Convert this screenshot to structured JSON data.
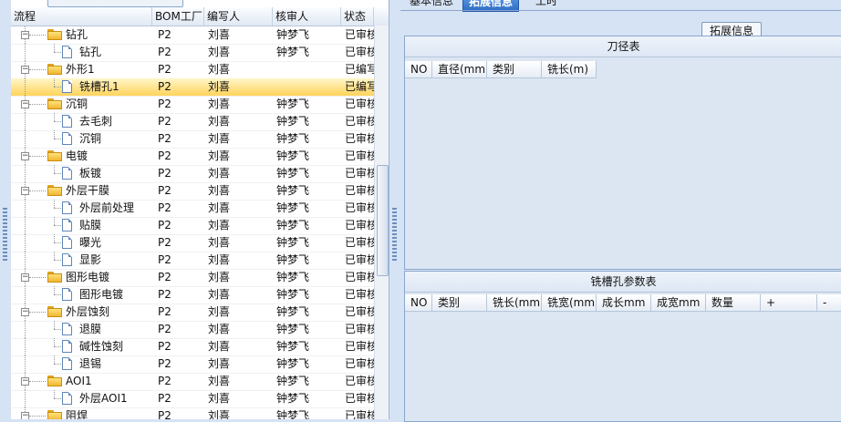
{
  "tree": {
    "columns": [
      "流程",
      "BOM工厂",
      "编写人",
      "核审人",
      "状态"
    ],
    "rows": [
      {
        "level": 1,
        "type": "folder",
        "name": "钻孔",
        "bom": "P2",
        "writer": "刘喜",
        "reviewer": "钟梦飞",
        "status": "已审核",
        "selected": false
      },
      {
        "level": 2,
        "type": "doc",
        "name": "钻孔",
        "bom": "P2",
        "writer": "刘喜",
        "reviewer": "钟梦飞",
        "status": "已审核",
        "selected": false
      },
      {
        "level": 1,
        "type": "folder",
        "name": "外形1",
        "bom": "P2",
        "writer": "刘喜",
        "reviewer": "",
        "status": "已编写",
        "selected": false
      },
      {
        "level": 2,
        "type": "doc",
        "name": "铣槽孔1",
        "bom": "P2",
        "writer": "刘喜",
        "reviewer": "",
        "status": "已编写",
        "selected": true
      },
      {
        "level": 1,
        "type": "folder",
        "name": "沉铜",
        "bom": "P2",
        "writer": "刘喜",
        "reviewer": "钟梦飞",
        "status": "已审核",
        "selected": false
      },
      {
        "level": 2,
        "type": "doc",
        "name": "去毛刺",
        "bom": "P2",
        "writer": "刘喜",
        "reviewer": "钟梦飞",
        "status": "已审核",
        "selected": false
      },
      {
        "level": 2,
        "type": "doc",
        "name": "沉铜",
        "bom": "P2",
        "writer": "刘喜",
        "reviewer": "钟梦飞",
        "status": "已审核",
        "selected": false
      },
      {
        "level": 1,
        "type": "folder",
        "name": "电镀",
        "bom": "P2",
        "writer": "刘喜",
        "reviewer": "钟梦飞",
        "status": "已审核",
        "selected": false
      },
      {
        "level": 2,
        "type": "doc",
        "name": "板镀",
        "bom": "P2",
        "writer": "刘喜",
        "reviewer": "钟梦飞",
        "status": "已审核",
        "selected": false
      },
      {
        "level": 1,
        "type": "folder",
        "name": "外层干膜",
        "bom": "P2",
        "writer": "刘喜",
        "reviewer": "钟梦飞",
        "status": "已审核",
        "selected": false
      },
      {
        "level": 2,
        "type": "doc",
        "name": "外层前处理",
        "bom": "P2",
        "writer": "刘喜",
        "reviewer": "钟梦飞",
        "status": "已审核",
        "selected": false
      },
      {
        "level": 2,
        "type": "doc",
        "name": "贴膜",
        "bom": "P2",
        "writer": "刘喜",
        "reviewer": "钟梦飞",
        "status": "已审核",
        "selected": false
      },
      {
        "level": 2,
        "type": "doc",
        "name": "曝光",
        "bom": "P2",
        "writer": "刘喜",
        "reviewer": "钟梦飞",
        "status": "已审核",
        "selected": false
      },
      {
        "level": 2,
        "type": "doc",
        "name": "显影",
        "bom": "P2",
        "writer": "刘喜",
        "reviewer": "钟梦飞",
        "status": "已审核",
        "selected": false
      },
      {
        "level": 1,
        "type": "folder",
        "name": "图形电镀",
        "bom": "P2",
        "writer": "刘喜",
        "reviewer": "钟梦飞",
        "status": "已审核",
        "selected": false
      },
      {
        "level": 2,
        "type": "doc",
        "name": "图形电镀",
        "bom": "P2",
        "writer": "刘喜",
        "reviewer": "钟梦飞",
        "status": "已审核",
        "selected": false
      },
      {
        "level": 1,
        "type": "folder",
        "name": "外层蚀刻",
        "bom": "P2",
        "writer": "刘喜",
        "reviewer": "钟梦飞",
        "status": "已审核",
        "selected": false
      },
      {
        "level": 2,
        "type": "doc",
        "name": "退膜",
        "bom": "P2",
        "writer": "刘喜",
        "reviewer": "钟梦飞",
        "status": "已审核",
        "selected": false
      },
      {
        "level": 2,
        "type": "doc",
        "name": "碱性蚀刻",
        "bom": "P2",
        "writer": "刘喜",
        "reviewer": "钟梦飞",
        "status": "已审核",
        "selected": false
      },
      {
        "level": 2,
        "type": "doc",
        "name": "退锡",
        "bom": "P2",
        "writer": "刘喜",
        "reviewer": "钟梦飞",
        "status": "已审核",
        "selected": false
      },
      {
        "level": 1,
        "type": "folder",
        "name": "AOI1",
        "bom": "P2",
        "writer": "刘喜",
        "reviewer": "钟梦飞",
        "status": "已审核",
        "selected": false
      },
      {
        "level": 2,
        "type": "doc",
        "name": "外层AOI1",
        "bom": "P2",
        "writer": "刘喜",
        "reviewer": "钟梦飞",
        "status": "已审核",
        "selected": false
      },
      {
        "level": 1,
        "type": "folder",
        "name": "阻焊",
        "bom": "P2",
        "writer": "刘喜",
        "reviewer": "钟梦飞",
        "status": "已审核",
        "selected": false
      }
    ]
  },
  "tabs": [
    {
      "label": "基本信息",
      "active": false
    },
    {
      "label": "拓展信息",
      "active": true
    },
    {
      "label": "工时",
      "active": false
    }
  ],
  "groupbox_title": "拓展信息",
  "cutter_table": {
    "title": "刀径表",
    "columns": [
      "NO",
      "直径(mm)",
      "类别",
      "铣长(m)"
    ]
  },
  "slot_table": {
    "title": "铣槽孔参数表",
    "columns": [
      "NO",
      "类别",
      "铣长(mm)",
      "铣宽(mm)",
      "成长mm",
      "成宽mm",
      "数量",
      "+",
      "-"
    ]
  }
}
